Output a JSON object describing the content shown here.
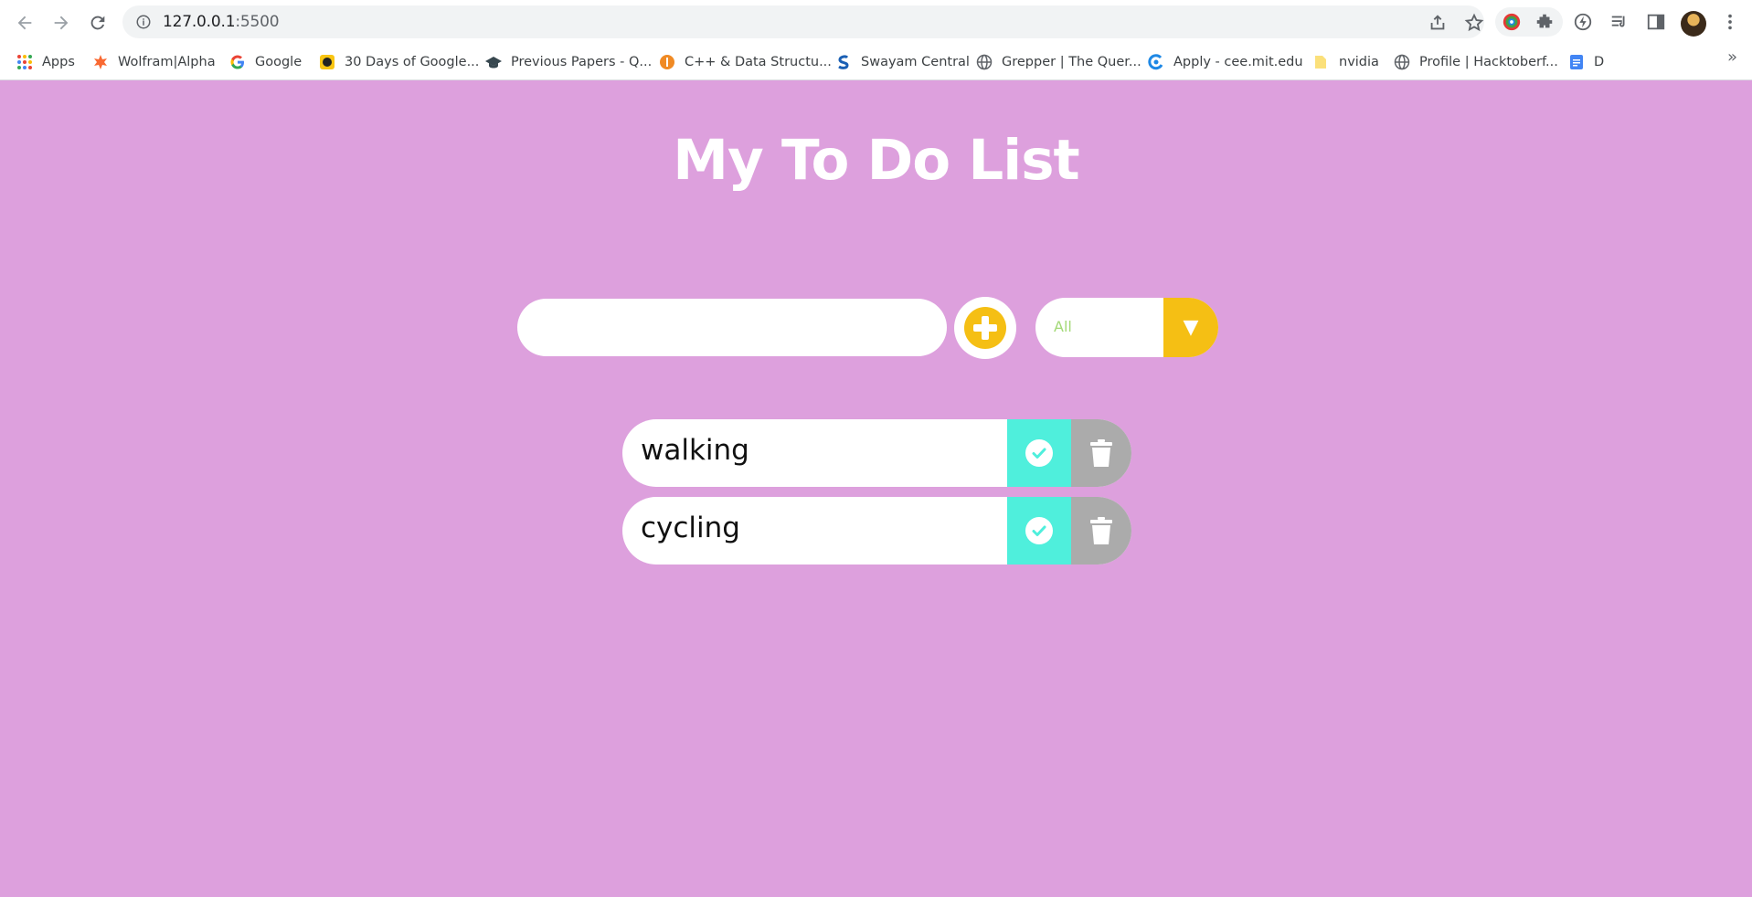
{
  "browser": {
    "url_host": "127.0.0.1",
    "url_port": ":5500",
    "bookmarks": [
      {
        "label": "Apps",
        "icon": "apps-grid-icon"
      },
      {
        "label": "Wolfram|Alpha",
        "icon": "wolfram-icon"
      },
      {
        "label": "Google",
        "icon": "google-icon"
      },
      {
        "label": "30 Days of Google...",
        "icon": "thirty-days-icon"
      },
      {
        "label": "Previous Papers - Q...",
        "icon": "graduation-cap-icon"
      },
      {
        "label": "C++ & Data Structu...",
        "icon": "cpp-icon"
      },
      {
        "label": "Swayam Central",
        "icon": "swayam-icon"
      },
      {
        "label": "Grepper | The Quer...",
        "icon": "globe-icon"
      },
      {
        "label": "Apply - cee.mit.edu",
        "icon": "mit-icon"
      },
      {
        "label": "nvidia",
        "icon": "folder-icon"
      },
      {
        "label": "Profile | Hacktoberf...",
        "icon": "globe-icon"
      },
      {
        "label": "D",
        "icon": "docs-icon"
      }
    ],
    "more_label": "»"
  },
  "page": {
    "title": "My To Do List",
    "input_value": "",
    "filter": {
      "selected": "All",
      "arrow": "▼"
    },
    "todos": [
      {
        "text": "walking"
      },
      {
        "text": "cycling"
      }
    ]
  },
  "colors": {
    "background": "#dda0dd",
    "accent_yellow": "#f5bf14",
    "complete_teal": "#4fefdc",
    "trash_gray": "#ababab",
    "filter_text": "#a3d977"
  }
}
